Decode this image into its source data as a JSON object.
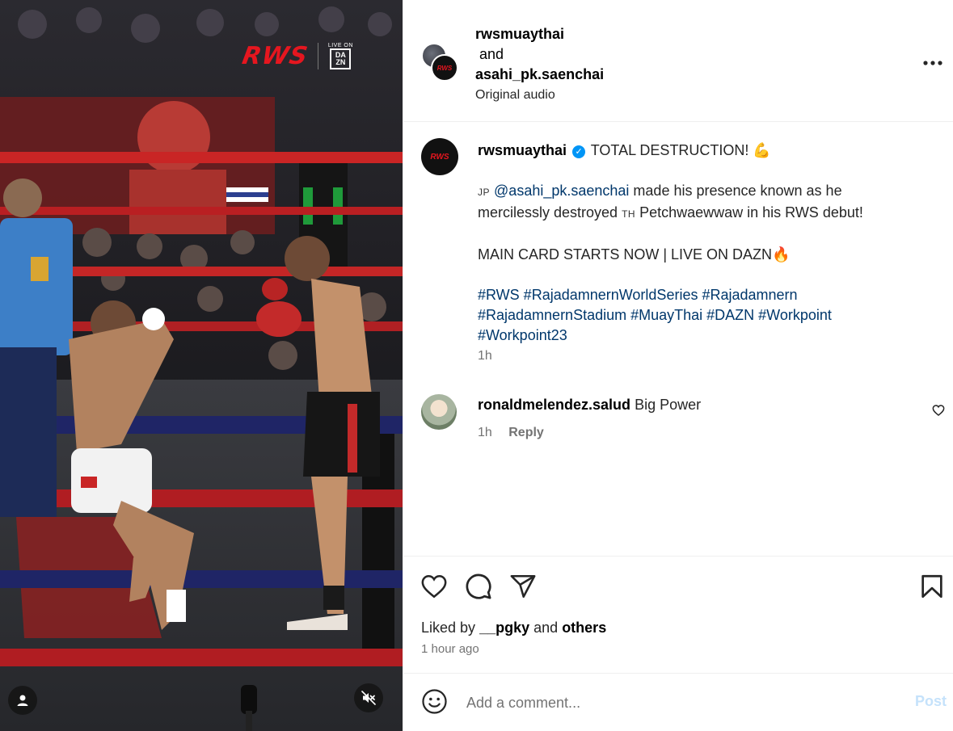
{
  "media": {
    "watermark_logo": "RWS",
    "live_on": "LIVE ON",
    "dazn_logo": "DA ZN",
    "icons": {
      "user": "user-icon",
      "mute": "speaker-muted-icon"
    }
  },
  "header": {
    "user1": "rwsmuaythai",
    "conjunction": "and",
    "user2": "asahi_pk.saenchai",
    "audio": "Original audio",
    "more_icon": "more-dots-icon",
    "avatar_text": "RWS"
  },
  "caption": {
    "username": "rwsmuaythai",
    "verified_icon": "verified-badge-icon",
    "headline": "TOTAL DESTRUCTION! 💪",
    "line1_flag": "JP",
    "line1_mention": "@asahi_pk.saenchai",
    "line1_text": " made his presence known as he",
    "line2_before": "mercilessly destroyed ",
    "line2_flag": "TH",
    "line2_after": " Petchwaewwaw in his RWS debut!",
    "main_card": "MAIN CARD STARTS NOW | LIVE ON DAZN🔥",
    "hashtags_line1": "#RWS #RajadamnernWorldSeries #Rajadamnern",
    "hashtags_line2": "#RajadamnernStadium #MuayThai #DAZN #Workpoint",
    "hashtags_line3": "#Workpoint23",
    "time": "1h"
  },
  "comment": {
    "username": "ronaldmelendez.salud",
    "text": "Big Power",
    "time": "1h",
    "reply": "Reply",
    "like_icon": "heart-icon"
  },
  "actions": {
    "icons": [
      "heart-icon",
      "comment-icon",
      "share-icon",
      "bookmark-icon"
    ],
    "liked_prefix": "Liked by",
    "liked_user": "__pgky",
    "liked_and": "and",
    "liked_others": "others",
    "time": "1 hour ago"
  },
  "comment_bar": {
    "emoji_icon": "emoji-icon",
    "placeholder": "Add a comment...",
    "post_label": "Post"
  },
  "colors": {
    "accent_link": "#00376b",
    "post_disabled": "#c5e2fb",
    "verified": "#0095f6",
    "rws_red": "#e5161f"
  }
}
